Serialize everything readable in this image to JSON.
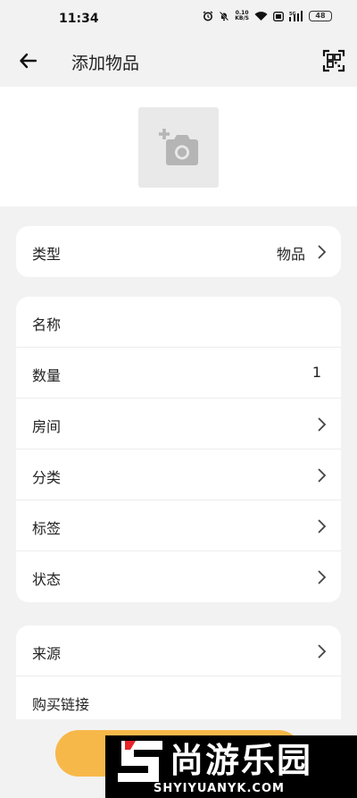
{
  "status_bar": {
    "time": "11:34",
    "net_speed_top": "0.10",
    "net_speed_bottom": "KB/S",
    "signal_label": "5G",
    "battery": "48"
  },
  "app_bar": {
    "title": "添加物品",
    "back_icon": "arrow-left-icon",
    "scan_icon": "qr-scan-icon"
  },
  "photo": {
    "icon": "add-camera-icon"
  },
  "type_card": {
    "label": "类型",
    "value": "物品"
  },
  "details_card": {
    "rows": [
      {
        "label": "名称",
        "value": ""
      },
      {
        "label": "数量",
        "value": "1"
      },
      {
        "label": "房间",
        "value": ""
      },
      {
        "label": "分类",
        "value": ""
      },
      {
        "label": "标签",
        "value": ""
      },
      {
        "label": "状态",
        "value": ""
      }
    ]
  },
  "source_card": {
    "rows": [
      {
        "label": "来源",
        "value": ""
      },
      {
        "label": "购买链接",
        "value": ""
      }
    ]
  },
  "watermark": {
    "name": "尚游乐园",
    "domain": "SHYIYUANYK.COM"
  },
  "colors": {
    "accent": "#f7b84a",
    "background": "#f2f2f2",
    "card": "#ffffff"
  }
}
